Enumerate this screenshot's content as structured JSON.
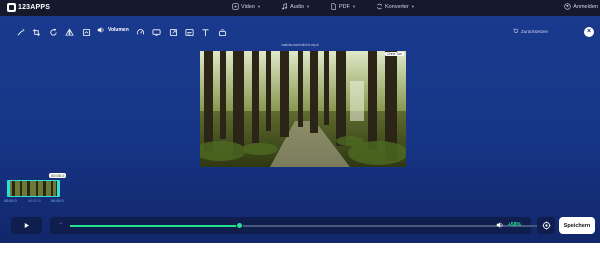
{
  "brand": {
    "name": "123APPS"
  },
  "nav": {
    "items": [
      {
        "label": "Video",
        "icon": "play-square-icon"
      },
      {
        "label": "Audio",
        "icon": "music-note-icon"
      },
      {
        "label": "PDF",
        "icon": "document-icon"
      },
      {
        "label": "Konverter",
        "icon": "convert-icon"
      }
    ],
    "login_label": "Anmelden"
  },
  "toolbar": {
    "tools": [
      "magic-icon",
      "crop-icon",
      "rotate-icon",
      "flip-icon",
      "stabilize-icon"
    ],
    "tools_after": [
      "speed-icon",
      "screen-icon",
      "resize-icon",
      "subtitle-icon",
      "text-icon",
      "rotate-frame-icon"
    ],
    "active_label": "Volumen",
    "reset_label": "Zurücksetzen",
    "close_symbol": "×"
  },
  "preview": {
    "filename": "waldsonnenlicht.mp4",
    "mute_label": "Ohne Ton"
  },
  "timeline": {
    "tooltip": "00:05.0",
    "start_time": "00:00.0",
    "mid_time": "00:02.5",
    "end_time": "00:05.0"
  },
  "controls": {
    "volume_percent": 0.36,
    "volume_text": "+58%",
    "save_label": "Speichern"
  },
  "colors": {
    "accent": "#22e38e",
    "background": "#173687",
    "nav": "#14192b",
    "clip_border": "#2fe0d0"
  }
}
